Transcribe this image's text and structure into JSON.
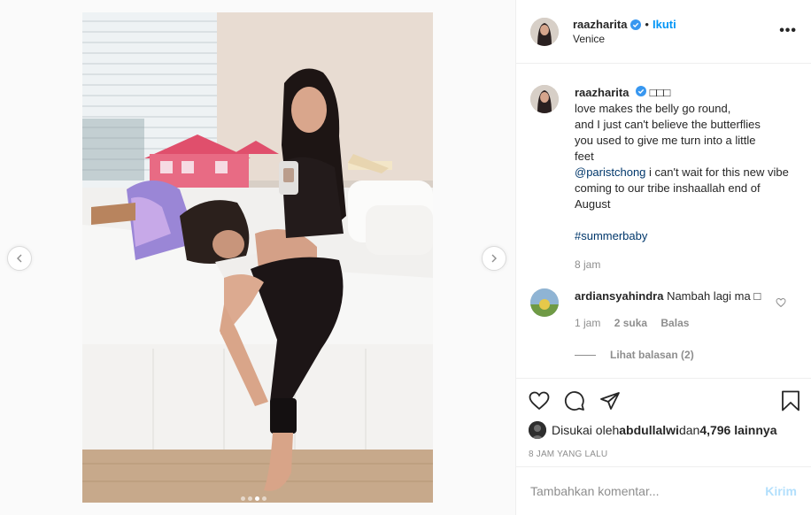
{
  "post": {
    "username": "raazharita",
    "follow_label": "Ikuti",
    "bullet": "•",
    "location": "Venice",
    "more_label": "•••"
  },
  "caption": {
    "username": "raazharita",
    "emoji": "□□□",
    "lines": [
      "love makes the belly go round,",
      "and I just can't believe the butterflies",
      "you used to give me turn into a little",
      "feet"
    ],
    "mention": "@paristchong",
    "mention_rest": " i can't wait for this new vibe coming to our tribe inshaallah end of August",
    "hashtag": "#summerbaby",
    "time": "8 jam"
  },
  "comment": {
    "username": "ardiansyahindra",
    "text": "Nambah lagi ma",
    "emoji": "□",
    "time": "1 jam",
    "likes": "2 suka",
    "reply_label": "Balas",
    "view_replies": "Lihat balasan (2)"
  },
  "likes": {
    "prefix": "Disukai oleh ",
    "user": "abdullalwi",
    "middle": " dan ",
    "count": "4,796 lainnya"
  },
  "timestamp": "8 JAM YANG LALU",
  "composer": {
    "placeholder": "Tambahkan komentar...",
    "post_label": "Kirim"
  },
  "carousel": {
    "total": 4,
    "active_index": 2
  },
  "colors": {
    "accent": "#0095f6",
    "link": "#00376b",
    "muted": "#8e8e8e",
    "border": "#efefef"
  }
}
